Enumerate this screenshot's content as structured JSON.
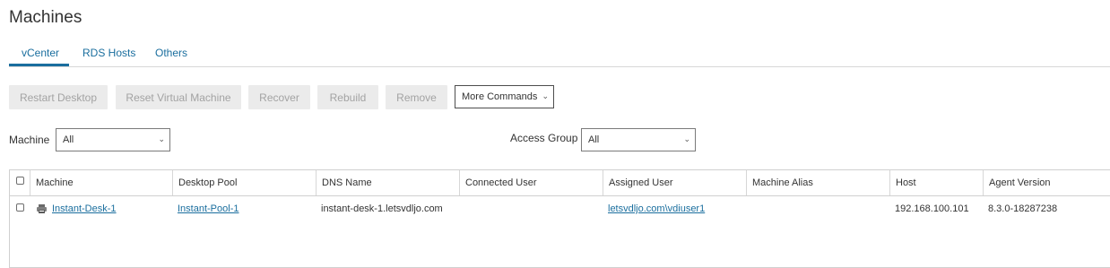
{
  "page": {
    "title": "Machines"
  },
  "tabs": [
    {
      "label": "vCenter",
      "active": true
    },
    {
      "label": "RDS Hosts"
    },
    {
      "label": "Others"
    }
  ],
  "toolbar": {
    "buttons": [
      "Restart Desktop",
      "Reset Virtual Machine",
      "Recover",
      "Rebuild",
      "Remove"
    ],
    "more_commands": "More Commands"
  },
  "filters": {
    "machine_label": "Machine",
    "machine_value": "All",
    "access_group_label": "Access Group",
    "access_group_value": "All"
  },
  "table": {
    "columns": [
      "Machine",
      "Desktop Pool",
      "DNS Name",
      "Connected User",
      "Assigned User",
      "Machine Alias",
      "Host",
      "Agent Version"
    ],
    "rows": [
      {
        "machine": "Instant-Desk-1",
        "desktop_pool": "Instant-Pool-1",
        "dns_name": "instant-desk-1.letsvdljo.com",
        "connected_user": "",
        "assigned_user": "letsvdljo.com\\vdiuser1",
        "machine_alias": "",
        "host": "192.168.100.101",
        "agent_version": "8.3.0-18287238"
      }
    ]
  },
  "colors": {
    "accent": "#1a6e9e",
    "disabled_bg": "#ebebeb",
    "disabled_text": "#a3a3a3"
  },
  "icons": {
    "machine_row": "vm-desktop-icon",
    "dropdown": "chevron-down-icon"
  }
}
